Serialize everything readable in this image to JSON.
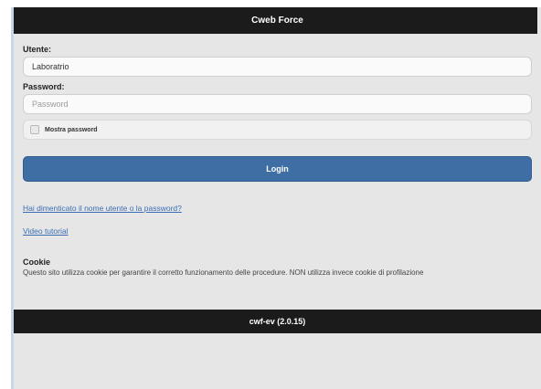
{
  "header": {
    "title": "Cweb Force"
  },
  "form": {
    "username_label": "Utente:",
    "username_value": "Laboratrio",
    "password_label": "Password:",
    "password_placeholder": "Password",
    "show_password_label": "Mostra password",
    "login_label": "Login"
  },
  "links": {
    "forgot": "Hai dimenticato il nome utente o la password?",
    "video": "Video tutorial"
  },
  "cookie": {
    "title": "Cookie",
    "text": "Questo sito utilizza cookie per garantire il corretto funzionamento delle procedure. NON utilizza invece cookie di profilazione"
  },
  "footer": {
    "version": "cwf-ev (2.0.15)"
  },
  "colors": {
    "header_bg": "#1b1b1b",
    "primary_button": "#3f6ea5",
    "link": "#3b6eb5",
    "page_bg": "#e6e6e6"
  }
}
